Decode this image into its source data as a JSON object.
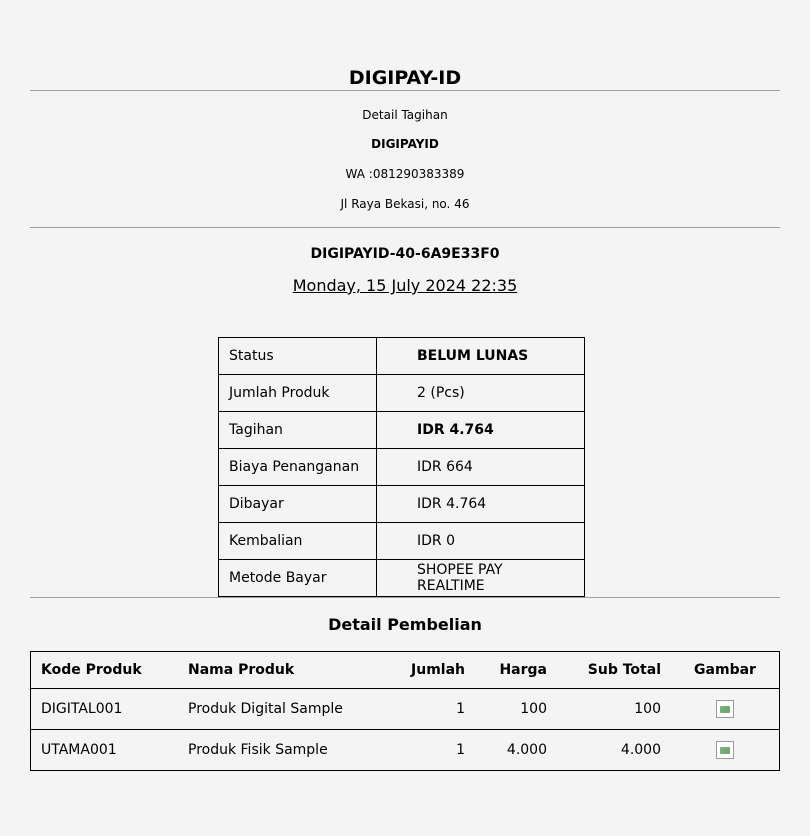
{
  "brand": "DIGIPAY-ID",
  "merchant": {
    "heading": "Detail Tagihan",
    "name": "DIGIPAYID",
    "phone": "WA :081290383389",
    "address": "Jl Raya Bekasi, no. 46"
  },
  "invoice": {
    "id": "DIGIPAYID-40-6A9E33F0",
    "date": "Monday, 15 July 2024 22:35"
  },
  "summary": [
    {
      "label": "Status",
      "value": "BELUM LUNAS",
      "bold": true
    },
    {
      "label": "Jumlah Produk",
      "value": "2 (Pcs)",
      "bold": false
    },
    {
      "label": "Tagihan",
      "value": "IDR 4.764",
      "bold": true
    },
    {
      "label": "Biaya Penanganan",
      "value": "IDR 664",
      "bold": false
    },
    {
      "label": "Dibayar",
      "value": "IDR 4.764",
      "bold": false
    },
    {
      "label": "Kembalian",
      "value": "IDR 0",
      "bold": false
    },
    {
      "label": "Metode Bayar",
      "value": "SHOPEE PAY REALTIME",
      "bold": false
    }
  ],
  "purchase": {
    "title": "Detail Pembelian",
    "headers": [
      "Kode Produk",
      "Nama Produk",
      "Jumlah",
      "Harga",
      "Sub Total",
      "Gambar"
    ],
    "rows": [
      {
        "code": "DIGITAL001",
        "name": "Produk Digital Sample",
        "qty": "1",
        "price": "100",
        "subtotal": "100",
        "image": "broken-image-icon"
      },
      {
        "code": "UTAMA001",
        "name": "Produk Fisik Sample",
        "qty": "1",
        "price": "4.000",
        "subtotal": "4.000",
        "image": "broken-image-icon"
      }
    ]
  }
}
